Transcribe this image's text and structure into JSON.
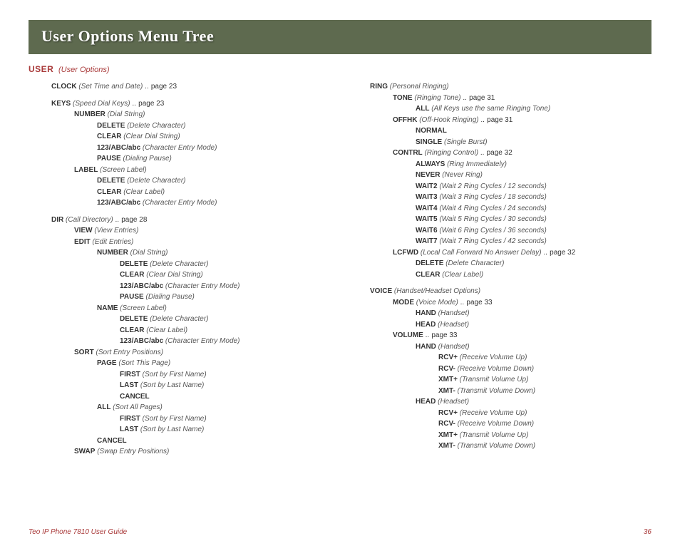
{
  "title": "User Options Menu Tree",
  "user": {
    "label": "USER",
    "sub": "(User Options)"
  },
  "footer": {
    "left": "Teo IP Phone 7810 User Guide",
    "right": "36"
  },
  "dots": "..................................................................................................................................",
  "left": [
    {
      "indent": 1,
      "label": "CLOCK",
      "desc": "(Set Time and Date)",
      "page": "page 23",
      "leader": true
    },
    {
      "gap": true
    },
    {
      "indent": 1,
      "label": "KEYS",
      "desc": "(Speed Dial Keys)",
      "page": "page 23",
      "leader": true
    },
    {
      "indent": 2,
      "label": "NUMBER",
      "desc": "(Dial String)"
    },
    {
      "indent": 3,
      "label": "DELETE",
      "desc": "(Delete Character)"
    },
    {
      "indent": 3,
      "label": "CLEAR",
      "desc": "(Clear Dial String)"
    },
    {
      "indent": 3,
      "label": "123/ABC/abc",
      "desc": "(Character Entry Mode)"
    },
    {
      "indent": 3,
      "label": "PAUSE",
      "desc": "(Dialing Pause)"
    },
    {
      "indent": 2,
      "label": "LABEL",
      "desc": "(Screen Label)"
    },
    {
      "indent": 3,
      "label": "DELETE",
      "desc": "(Delete Character)"
    },
    {
      "indent": 3,
      "label": "CLEAR",
      "desc": "(Clear Label)"
    },
    {
      "indent": 3,
      "label": "123/ABC/abc",
      "desc": "(Character Entry Mode)"
    },
    {
      "gap": true
    },
    {
      "indent": 1,
      "label": "DIR",
      "desc": "(Call Directory)",
      "page": "page 28",
      "leader": true
    },
    {
      "indent": 2,
      "label": "VIEW",
      "desc": "(View Entries)"
    },
    {
      "indent": 2,
      "label": "EDIT",
      "desc": "(Edit Entries)"
    },
    {
      "indent": 3,
      "label": "NUMBER",
      "desc": "(Dial String)"
    },
    {
      "indent": 4,
      "label": "DELETE",
      "desc": "(Delete Character)"
    },
    {
      "indent": 4,
      "label": "CLEAR",
      "desc": "(Clear Dial String)"
    },
    {
      "indent": 4,
      "label": "123/ABC/abc",
      "desc": "(Character Entry Mode)"
    },
    {
      "indent": 4,
      "label": "PAUSE",
      "desc": "(Dialing Pause)"
    },
    {
      "indent": 3,
      "label": "NAME",
      "desc": "(Screen Label)"
    },
    {
      "indent": 4,
      "label": "DELETE",
      "desc": "(Delete Character)"
    },
    {
      "indent": 4,
      "label": "CLEAR",
      "desc": "(Clear Label)"
    },
    {
      "indent": 4,
      "label": "123/ABC/abc",
      "desc": "(Character Entry Mode)"
    },
    {
      "indent": 2,
      "label": "SORT",
      "desc": "(Sort Entry Positions)"
    },
    {
      "indent": 3,
      "label": "PAGE",
      "desc": "(Sort This Page)"
    },
    {
      "indent": 4,
      "label": "FIRST",
      "desc": "(Sort by First Name)"
    },
    {
      "indent": 4,
      "label": "LAST",
      "desc": "(Sort by Last Name)"
    },
    {
      "indent": 4,
      "label": "CANCEL",
      "desc": ""
    },
    {
      "indent": 3,
      "label": "ALL",
      "desc": "(Sort All Pages)"
    },
    {
      "indent": 4,
      "label": "FIRST",
      "desc": "(Sort by First Name)"
    },
    {
      "indent": 4,
      "label": "LAST",
      "desc": "(Sort by Last Name)"
    },
    {
      "indent": 3,
      "label": "CANCEL",
      "desc": ""
    },
    {
      "indent": 2,
      "label": "SWAP",
      "desc": "(Swap Entry Positions)"
    }
  ],
  "right": [
    {
      "indent": 1,
      "label": "RING",
      "desc": "(Personal Ringing)"
    },
    {
      "indent": 2,
      "label": "TONE",
      "desc": "(Ringing Tone)",
      "page": "page 31",
      "leader": true
    },
    {
      "indent": 3,
      "label": "ALL",
      "desc": "(All Keys use the same Ringing Tone)"
    },
    {
      "indent": 2,
      "label": "OFFHK",
      "desc": "(Off-Hook Ringing)",
      "page": "page 31",
      "leader": true
    },
    {
      "indent": 3,
      "label": "NORMAL",
      "desc": ""
    },
    {
      "indent": 3,
      "label": "SINGLE",
      "desc": "(Single Burst)"
    },
    {
      "indent": 2,
      "label": "CONTRL",
      "desc": "(Ringing Control)",
      "page": "page 32",
      "leader": true
    },
    {
      "indent": 3,
      "label": "ALWAYS",
      "desc": "(Ring Immediately)"
    },
    {
      "indent": 3,
      "label": "NEVER",
      "desc": "(Never Ring)"
    },
    {
      "indent": 3,
      "label": "WAIT2",
      "desc": "(Wait 2 Ring Cycles / 12 seconds)"
    },
    {
      "indent": 3,
      "label": "WAIT3",
      "desc": "(Wait 3 Ring Cycles / 18 seconds)"
    },
    {
      "indent": 3,
      "label": "WAIT4",
      "desc": "(Wait 4 Ring Cycles / 24 seconds)"
    },
    {
      "indent": 3,
      "label": "WAIT5",
      "desc": "(Wait 5 Ring Cycles / 30 seconds)"
    },
    {
      "indent": 3,
      "label": "WAIT6",
      "desc": "(Wait 6 Ring Cycles / 36 seconds)"
    },
    {
      "indent": 3,
      "label": "WAIT7",
      "desc": "(Wait 7 Ring Cycles / 42 seconds)"
    },
    {
      "indent": 2,
      "label": "LCFWD",
      "desc": "(Local Call Forward No Answer Delay)",
      "page": "page  32",
      "leader": true
    },
    {
      "indent": 3,
      "label": "DELETE",
      "desc": "(Delete Character)"
    },
    {
      "indent": 3,
      "label": "CLEAR",
      "desc": "(Clear Label)"
    },
    {
      "gap": true
    },
    {
      "indent": 1,
      "label": "VOICE",
      "desc": "(Handset/Headset Options)"
    },
    {
      "indent": 2,
      "label": "MODE",
      "desc": "(Voice Mode)",
      "page": "page 33",
      "leader": true
    },
    {
      "indent": 3,
      "label": "HAND",
      "desc": "(Handset)"
    },
    {
      "indent": 3,
      "label": "HEAD",
      "desc": "(Headset)"
    },
    {
      "indent": 2,
      "label": "VOLUME",
      "desc": "",
      "page": "page 33",
      "leader": true
    },
    {
      "indent": 3,
      "label": "HAND",
      "desc": "(Handset)"
    },
    {
      "indent": 4,
      "label": "RCV+",
      "desc": "(Receive Volume Up)"
    },
    {
      "indent": 4,
      "label": "RCV-",
      "desc": "(Receive Volume Down)"
    },
    {
      "indent": 4,
      "label": "XMT+",
      "desc": "(Transmit Volume Up)"
    },
    {
      "indent": 4,
      "label": "XMT-",
      "desc": "(Transmit Volume Down)"
    },
    {
      "indent": 3,
      "label": "HEAD",
      "desc": "(Headset)"
    },
    {
      "indent": 4,
      "label": "RCV+",
      "desc": "(Receive Volume Up)"
    },
    {
      "indent": 4,
      "label": "RCV-",
      "desc": "(Receive Volume Down)"
    },
    {
      "indent": 4,
      "label": "XMT+",
      "desc": "(Transmit Volume Up)"
    },
    {
      "indent": 4,
      "label": "XMT-",
      "desc": "(Transmit Volume Down)"
    }
  ]
}
